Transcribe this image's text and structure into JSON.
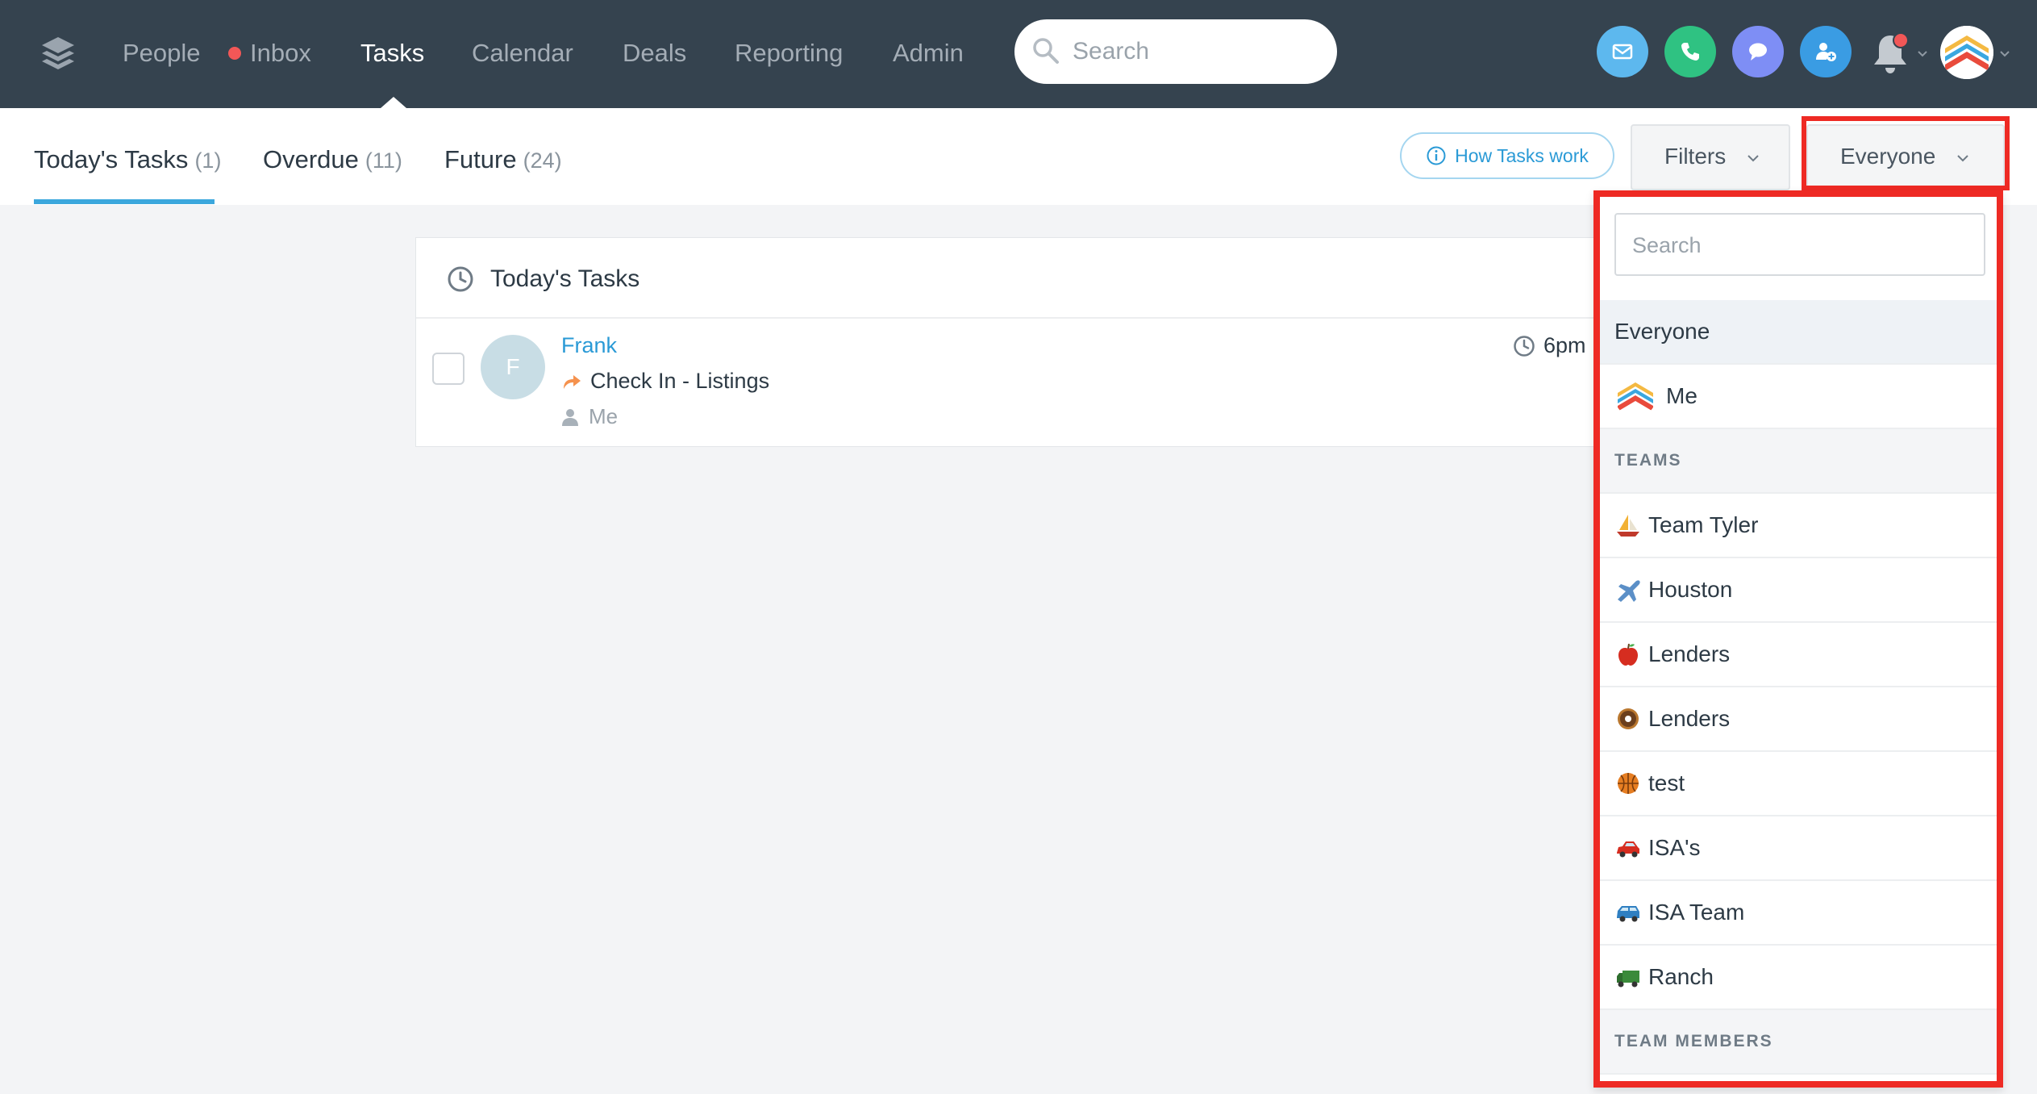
{
  "nav": {
    "items": [
      {
        "label": "People"
      },
      {
        "label": "Inbox"
      },
      {
        "label": "Tasks"
      },
      {
        "label": "Calendar"
      },
      {
        "label": "Deals"
      },
      {
        "label": "Reporting"
      },
      {
        "label": "Admin"
      }
    ],
    "active": "Tasks",
    "search_placeholder": "Search"
  },
  "action_icons": [
    "email-icon",
    "phone-icon",
    "chat-icon",
    "add-person-icon",
    "bell-icon"
  ],
  "colors": {
    "nav_bg": "#35434f",
    "email": "#5db8ee",
    "phone": "#2fc282",
    "chat": "#7e8ef5",
    "add_person": "#3a9ce3",
    "accent": "#3ba7dd",
    "highlight": "#ee2a24",
    "notification": "#f25757"
  },
  "tabs": [
    {
      "label": "Today's Tasks",
      "count": "(1)"
    },
    {
      "label": "Overdue",
      "count": "(11)"
    },
    {
      "label": "Future",
      "count": "(24)"
    }
  ],
  "toolbar": {
    "how_label": "How Tasks work",
    "filters_label": "Filters",
    "assignee_label": "Everyone"
  },
  "card": {
    "title": "Today's Tasks",
    "task": {
      "avatar_initial": "F",
      "contact": "Frank",
      "description": "Check In - Listings",
      "assignee": "Me",
      "due": "6pm"
    }
  },
  "dropdown": {
    "search_placeholder": "Search",
    "everyone": "Everyone",
    "me": "Me",
    "teams_header": "TEAMS",
    "teams": [
      {
        "name": "Team Tyler",
        "icon": "sailboat-icon"
      },
      {
        "name": "Houston",
        "icon": "airplane-icon"
      },
      {
        "name": "Lenders",
        "icon": "apple-icon"
      },
      {
        "name": "Lenders",
        "icon": "donut-icon"
      },
      {
        "name": "test",
        "icon": "basketball-icon"
      },
      {
        "name": "ISA's",
        "icon": "red-car-icon"
      },
      {
        "name": "ISA Team",
        "icon": "blue-car-icon"
      },
      {
        "name": "Ranch",
        "icon": "truck-icon"
      }
    ],
    "members_header": "TEAM MEMBERS"
  }
}
